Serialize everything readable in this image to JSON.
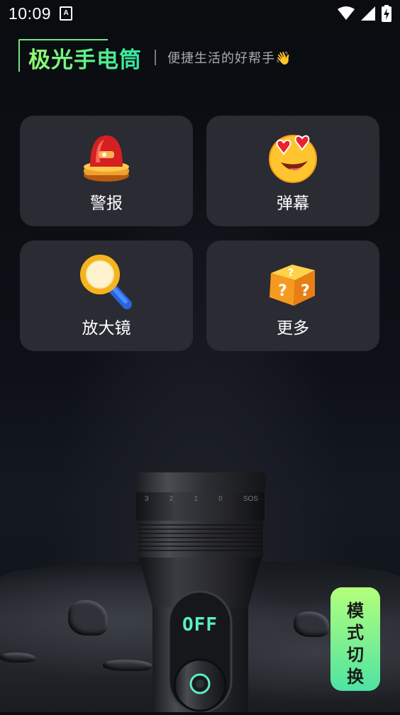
{
  "status_bar": {
    "time": "10:09",
    "notification_icon": "a-notification-icon",
    "icons": [
      "wifi-icon",
      "cell-signal-icon",
      "battery-charging-icon"
    ]
  },
  "header": {
    "app_name": "极光手电筒",
    "slogan": "便捷生活的好帮手👋"
  },
  "features": [
    {
      "label": "警报",
      "icon": "siren-icon"
    },
    {
      "label": "弹幕",
      "icon": "heart-eyes-emoji-icon"
    },
    {
      "label": "放大镜",
      "icon": "magnifier-icon"
    },
    {
      "label": "更多",
      "icon": "question-cube-icon"
    }
  ],
  "flashlight": {
    "dial_marks": [
      "3",
      "2",
      "1",
      "0",
      "SOS"
    ],
    "state": "OFF"
  },
  "mode_switch": {
    "chars": [
      "模",
      "式",
      "切",
      "换"
    ]
  },
  "colors": {
    "accent_green": "#9dff6b",
    "accent_teal": "#2ee6a0",
    "card_bg": "#2a2b33",
    "off_text": "#5cf0c0"
  }
}
